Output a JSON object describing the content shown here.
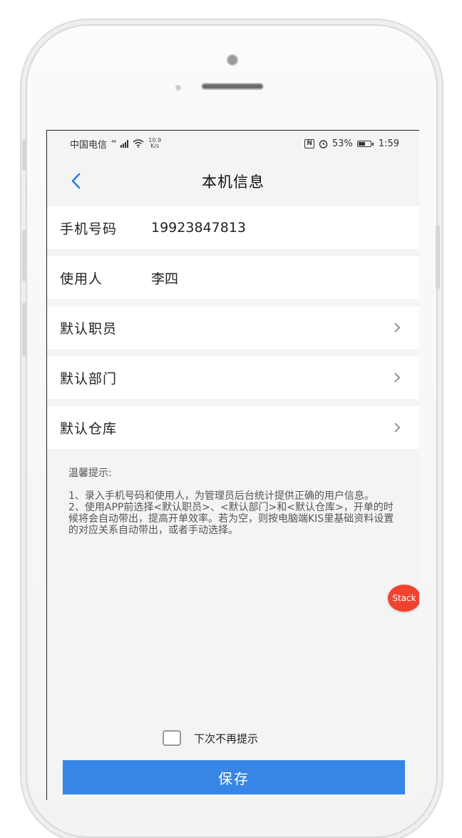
{
  "status_bar": {
    "carrier": "中国电信",
    "network": "⁴⁶",
    "speed_value": "10.9",
    "speed_unit": "K/s",
    "nfc": "N",
    "battery": "53%",
    "time": "1:59"
  },
  "nav": {
    "title": "本机信息"
  },
  "form": {
    "phone_label": "手机号码",
    "phone_value": "19923847813",
    "user_label": "使用人",
    "user_value": "李四",
    "default_staff_label": "默认职员",
    "default_dept_label": "默认部门",
    "default_warehouse_label": "默认仓库"
  },
  "tips": {
    "title": "温馨提示:",
    "line1": "1、录入手机号码和使用人，为管理员后台统计提供正确的用户信息。",
    "line2": "2、使用APP前选择<默认职员>、<默认部门>和<默认仓库>，开单的时候将会自动带出，提高开单效率。若为空，则按电脑端KIS里基础资料设置的对应关系自动带出，或者手动选择。"
  },
  "stack_label": "Stack",
  "dont_show_again": "下次不再提示",
  "save_label": "保存",
  "colors": {
    "accent": "#3786e6",
    "stack_red": "#f0432f",
    "background": "#f4f4f4"
  }
}
